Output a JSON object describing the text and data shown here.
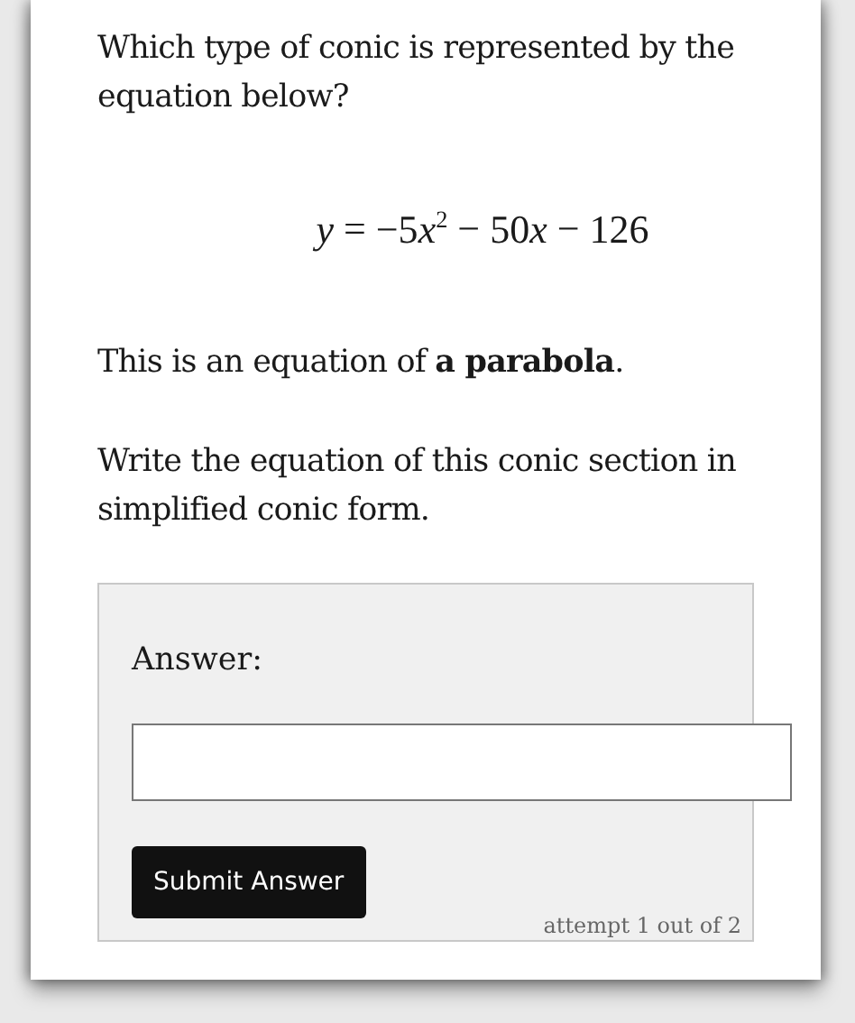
{
  "question": "Which type of conic is represented by the equation below?",
  "equation": [
    {
      "kind": "var",
      "text": "y"
    },
    {
      "kind": "op",
      "text": "="
    },
    {
      "kind": "num",
      "text": "−5"
    },
    {
      "kind": "var",
      "text": "x"
    },
    {
      "kind": "sup",
      "text": "2"
    },
    {
      "kind": "op",
      "text": "−"
    },
    {
      "kind": "num",
      "text": "50"
    },
    {
      "kind": "var",
      "text": "x"
    },
    {
      "kind": "op",
      "text": "−"
    },
    {
      "kind": "num",
      "text": "126"
    }
  ],
  "statement": "This is an equation of **a parabola**.",
  "instruction": "Write the equation of this conic section in simplified conic form.",
  "answer": {
    "label": "Answer:",
    "button": "Submit Answer",
    "attempt": "attempt 1 out of 2"
  }
}
